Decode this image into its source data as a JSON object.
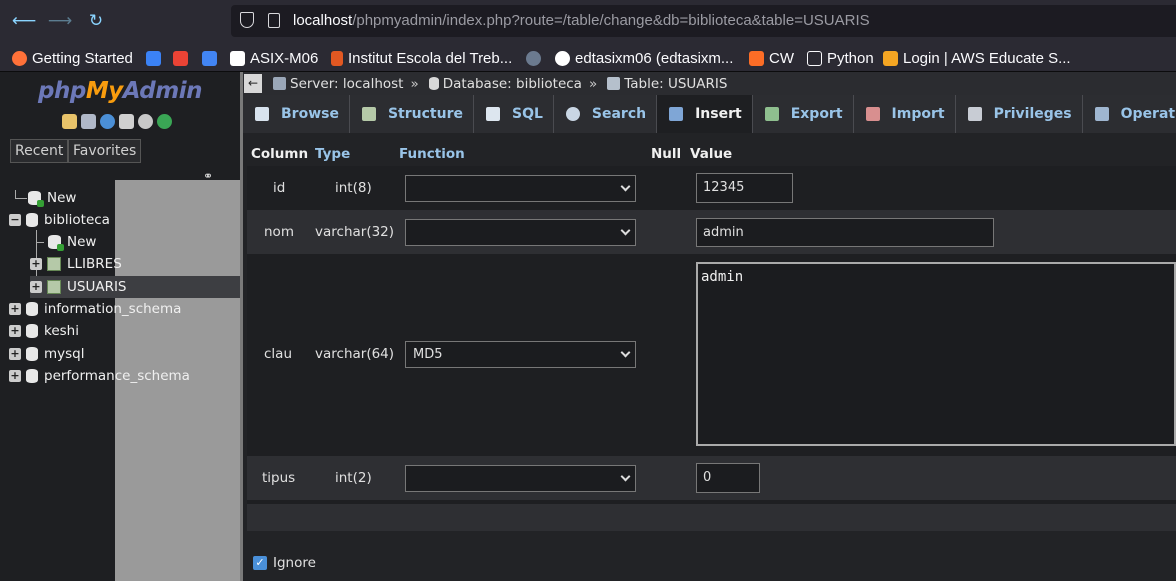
{
  "browser": {
    "url_host": "localhost",
    "url_path": "/phpmyadmin/index.php?route=/table/change&db=biblioteca&table=USUARIS",
    "bookmarks": [
      {
        "label": "Getting Started",
        "icon": "firefox-icon",
        "color": "#ff7139"
      },
      {
        "label": "",
        "icon": "check-icon",
        "color": "#3b82f6"
      },
      {
        "label": "",
        "icon": "gmail-icon",
        "color": "#ea4335"
      },
      {
        "label": "",
        "icon": "calendar-icon",
        "color": "#4285f4"
      },
      {
        "label": "ASIX-M06",
        "icon": "trello-icon",
        "color": "#ffffff"
      },
      {
        "label": "Institut Escola del Treb...",
        "icon": "school-icon",
        "color": "#e25822"
      },
      {
        "label": "",
        "icon": "circle-icon",
        "color": "#6b7a8f"
      },
      {
        "label": "edtasixm06 (edtasixm...",
        "icon": "github-icon",
        "color": "#ffffff"
      },
      {
        "label": "CW",
        "icon": "gitlab-icon",
        "color": "#fc6d26"
      },
      {
        "label": "Python",
        "icon": "folder-icon",
        "color": "#fbfbfe"
      },
      {
        "label": "Login | AWS Educate S...",
        "icon": "aws-icon",
        "color": "#f5a623"
      }
    ]
  },
  "nav": {
    "logo_php": "php",
    "logo_my": "My",
    "logo_admin": "Admin",
    "recent": "Recent",
    "favorites": "Favorites",
    "tree": [
      {
        "label": "New",
        "kind": "new"
      },
      {
        "label": "biblioteca",
        "kind": "db"
      },
      {
        "label": "New",
        "kind": "new"
      },
      {
        "label": "LLIBRES",
        "kind": "table"
      },
      {
        "label": "USUARIS",
        "kind": "table"
      },
      {
        "label": "information_schema",
        "kind": "db"
      },
      {
        "label": "keshi",
        "kind": "db"
      },
      {
        "label": "mysql",
        "kind": "db"
      },
      {
        "label": "performance_schema",
        "kind": "db"
      }
    ]
  },
  "breadcrumb": {
    "server": "Server: localhost",
    "sep": "»",
    "database": "Database: biblioteca",
    "table": "Table: USUARIS"
  },
  "tabs": [
    {
      "label": "Browse",
      "icon": "browse-icon"
    },
    {
      "label": "Structure",
      "icon": "structure-icon"
    },
    {
      "label": "SQL",
      "icon": "sql-icon"
    },
    {
      "label": "Search",
      "icon": "search-icon"
    },
    {
      "label": "Insert",
      "icon": "insert-icon",
      "active": true
    },
    {
      "label": "Export",
      "icon": "export-icon"
    },
    {
      "label": "Import",
      "icon": "import-icon"
    },
    {
      "label": "Privileges",
      "icon": "privileges-icon"
    },
    {
      "label": "Operations",
      "icon": "operations-icon"
    }
  ],
  "insert_form": {
    "headers": {
      "column": "Column",
      "type": "Type",
      "function": "Function",
      "null": "Null",
      "value": "Value"
    },
    "rows": [
      {
        "column": "id",
        "type": "int(8)",
        "function": "",
        "value": "12345"
      },
      {
        "column": "nom",
        "type": "varchar(32)",
        "function": "",
        "value": "admin"
      },
      {
        "column": "clau",
        "type": "varchar(64)",
        "function": "MD5",
        "value": "admin"
      },
      {
        "column": "tipus",
        "type": "int(2)",
        "function": "",
        "value": "0"
      }
    ],
    "ignore_label": "Ignore",
    "ignore_checked": true
  }
}
